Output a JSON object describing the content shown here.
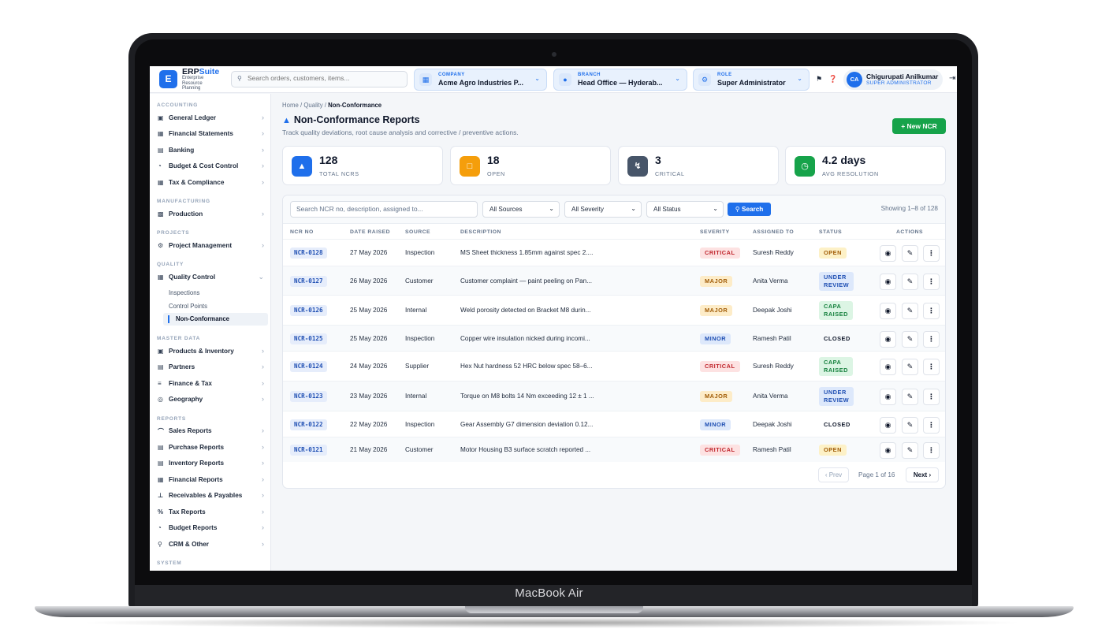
{
  "device_label": "MacBook Air",
  "topbar": {
    "logo_letter": "E",
    "brand_main": "ERP",
    "brand_accent": "Suite",
    "brand_sub": "Enterprise Resource Planning",
    "search_placeholder": "Search orders, customers, items...",
    "company": {
      "label": "COMPANY",
      "value": "Acme Agro Industries P..."
    },
    "branch": {
      "label": "BRANCH",
      "value": "Head Office — Hyderab..."
    },
    "role": {
      "label": "ROLE",
      "value": "Super Administrator"
    },
    "user": {
      "initials": "CA",
      "name": "Chigurupati Anilkumar",
      "role": "SUPER ADMINISTRATOR"
    }
  },
  "sidebar": {
    "accounting": "ACCOUNTING",
    "general_ledger": "General Ledger",
    "financial_statements": "Financial Statements",
    "banking": "Banking",
    "budget_cost": "Budget & Cost Control",
    "tax_compliance": "Tax & Compliance",
    "manufacturing": "MANUFACTURING",
    "production": "Production",
    "projects": "PROJECTS",
    "project_management": "Project Management",
    "quality": "QUALITY",
    "quality_control": "Quality Control",
    "inspections": "Inspections",
    "control_points": "Control Points",
    "non_conformance": "Non-Conformance",
    "master_data": "MASTER DATA",
    "products_inventory": "Products & Inventory",
    "partners": "Partners",
    "finance_tax": "Finance & Tax",
    "geography": "Geography",
    "reports": "REPORTS",
    "sales_reports": "Sales Reports",
    "purchase_reports": "Purchase Reports",
    "inventory_reports": "Inventory Reports",
    "financial_reports": "Financial Reports",
    "receivables_payables": "Receivables & Payables",
    "tax_reports": "Tax Reports",
    "budget_reports": "Budget Reports",
    "crm_other": "CRM & Other",
    "system": "SYSTEM"
  },
  "breadcrumb": {
    "home": "Home",
    "sep1": "/",
    "quality": "Quality",
    "sep2": "/",
    "current": "Non-Conformance"
  },
  "page": {
    "title": "Non-Conformance Reports",
    "subtitle": "Track quality deviations, root cause analysis and corrective / preventive actions.",
    "new_button": "+ New NCR"
  },
  "stats": [
    {
      "value": "128",
      "label": "TOTAL NCRS",
      "color": "#1f6feb"
    },
    {
      "value": "18",
      "label": "OPEN",
      "color": "#f59e0b"
    },
    {
      "value": "3",
      "label": "CRITICAL",
      "color": "#475569"
    },
    {
      "value": "4.2 days",
      "label": "AVG RESOLUTION",
      "color": "#16a34a"
    }
  ],
  "filters": {
    "search_placeholder": "Search NCR no, description, assigned to...",
    "sources": "All Sources",
    "severity": "All Severity",
    "status": "All Status",
    "search_button": "Search",
    "showing": "Showing 1–8 of 128"
  },
  "table": {
    "headers": {
      "ncr_no": "NCR NO",
      "date_raised": "DATE RAISED",
      "source": "SOURCE",
      "description": "DESCRIPTION",
      "severity": "SEVERITY",
      "assigned_to": "ASSIGNED TO",
      "status": "STATUS",
      "actions": "ACTIONS"
    },
    "rows": [
      {
        "id": "NCR-0128",
        "date": "27 May 2026",
        "source": "Inspection",
        "desc": "MS Sheet thickness 1.85mm against spec 2....",
        "severity": "CRITICAL",
        "assigned": "Suresh Reddy",
        "status1": "OPEN",
        "status2": ""
      },
      {
        "id": "NCR-0127",
        "date": "26 May 2026",
        "source": "Customer",
        "desc": "Customer complaint — paint peeling on Pan...",
        "severity": "MAJOR",
        "assigned": "Anita Verma",
        "status1": "UNDER",
        "status2": "REVIEW"
      },
      {
        "id": "NCR-0126",
        "date": "25 May 2026",
        "source": "Internal",
        "desc": "Weld porosity detected on Bracket M8 durin...",
        "severity": "MAJOR",
        "assigned": "Deepak Joshi",
        "status1": "CAPA",
        "status2": "RAISED"
      },
      {
        "id": "NCR-0125",
        "date": "25 May 2026",
        "source": "Inspection",
        "desc": "Copper wire insulation nicked during incomi...",
        "severity": "MINOR",
        "assigned": "Ramesh Patil",
        "status1": "CLOSED",
        "status2": ""
      },
      {
        "id": "NCR-0124",
        "date": "24 May 2026",
        "source": "Supplier",
        "desc": "Hex Nut hardness 52 HRC below spec 58–6...",
        "severity": "CRITICAL",
        "assigned": "Suresh Reddy",
        "status1": "CAPA",
        "status2": "RAISED"
      },
      {
        "id": "NCR-0123",
        "date": "23 May 2026",
        "source": "Internal",
        "desc": "Torque on M8 bolts 14 Nm exceeding 12 ± 1 ...",
        "severity": "MAJOR",
        "assigned": "Anita Verma",
        "status1": "UNDER",
        "status2": "REVIEW"
      },
      {
        "id": "NCR-0122",
        "date": "22 May 2026",
        "source": "Inspection",
        "desc": "Gear Assembly G7 dimension deviation 0.12...",
        "severity": "MINOR",
        "assigned": "Deepak Joshi",
        "status1": "CLOSED",
        "status2": ""
      },
      {
        "id": "NCR-0121",
        "date": "21 May 2026",
        "source": "Customer",
        "desc": "Motor Housing B3 surface scratch reported ...",
        "severity": "CRITICAL",
        "assigned": "Ramesh Patil",
        "status1": "OPEN",
        "status2": ""
      }
    ]
  },
  "pager": {
    "prev": "‹ Prev",
    "info": "Page 1 of 16",
    "next": "Next ›"
  }
}
